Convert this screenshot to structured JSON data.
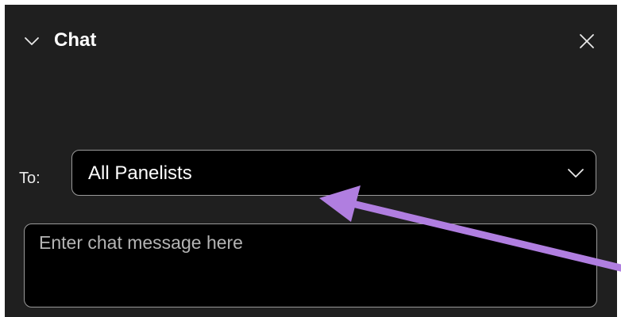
{
  "header": {
    "title": "Chat",
    "collapse_icon": "chevron-down-icon",
    "close_icon": "close-icon"
  },
  "recipient": {
    "label": "To:",
    "selected": "All Panelists",
    "dropdown_icon": "chevron-down-icon"
  },
  "message": {
    "value": "",
    "placeholder": "Enter chat message here"
  },
  "annotation": {
    "type": "arrow",
    "color": "#b07ee0"
  },
  "colors": {
    "panel_background": "#1f1f1f",
    "field_background": "#000000",
    "field_border": "#9a9a9a",
    "text": "#ffffff"
  }
}
